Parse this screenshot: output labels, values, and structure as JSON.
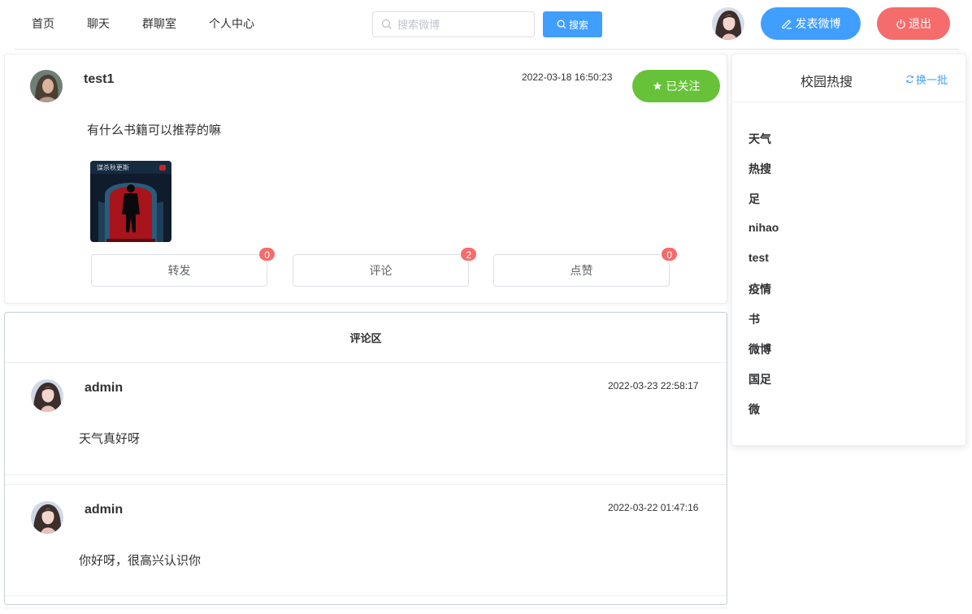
{
  "nav": {
    "items": [
      "首页",
      "聊天",
      "群聊室",
      "个人中心"
    ],
    "search_placeholder": "搜索微博",
    "search_button": "搜索",
    "post_button": "发表微博",
    "logout_button": "退出"
  },
  "post": {
    "username": "test1",
    "time": "2022-03-18 16:50:23",
    "follow_button": "已关注",
    "text": "有什么书籍可以推荐的嘛",
    "image_caption": "谋杀秋更斯",
    "actions": [
      {
        "label": "转发",
        "count": "0"
      },
      {
        "label": "评论",
        "count": "2"
      },
      {
        "label": "点赞",
        "count": "0"
      }
    ]
  },
  "comments": {
    "title": "评论区",
    "items": [
      {
        "username": "admin",
        "time": "2022-03-23 22:58:17",
        "text": "天气真好呀"
      },
      {
        "username": "admin",
        "time": "2022-03-22 01:47:16",
        "text": "你好呀，很高兴认识你"
      }
    ]
  },
  "hot_search": {
    "title": "校园热搜",
    "refresh": "换一批",
    "items": [
      "天气",
      "热搜",
      "足",
      "nihao",
      "test",
      "疫情",
      "书",
      "微博",
      "国足",
      "微"
    ]
  },
  "colors": {
    "primary": "#409eff",
    "success": "#67c23a",
    "danger": "#f56c6c"
  }
}
